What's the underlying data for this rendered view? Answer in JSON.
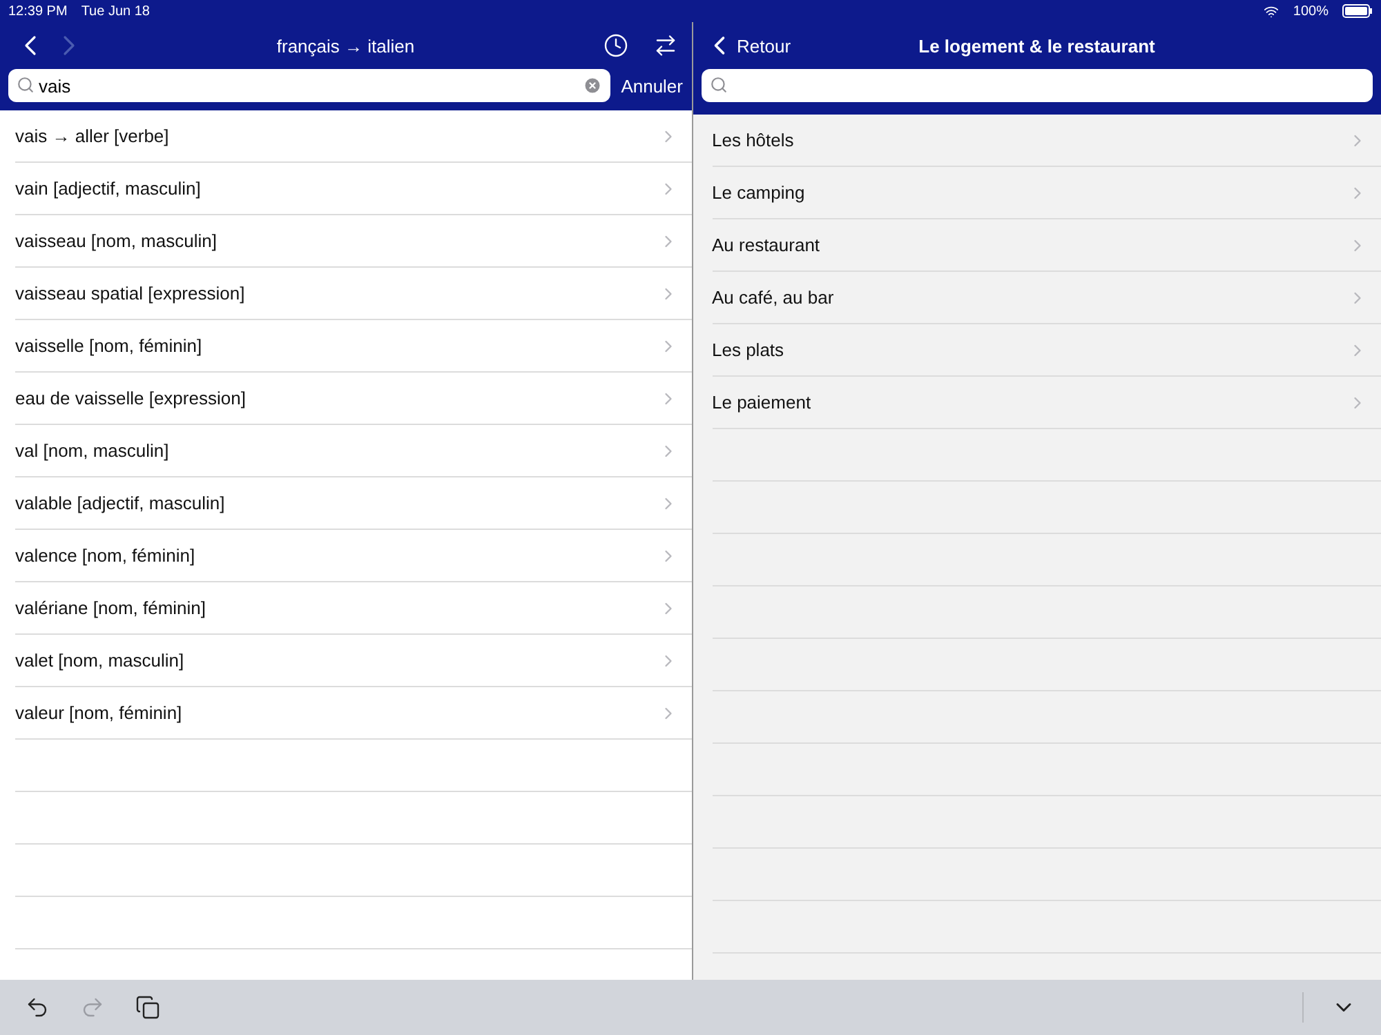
{
  "status_bar": {
    "time": "12:39 PM",
    "date": "Tue Jun 18",
    "battery": "100%"
  },
  "left_panel": {
    "nav": [
      {
        "kind": "back",
        "disabled": false
      },
      {
        "kind": "forward",
        "disabled": true
      }
    ],
    "title": "français → italien",
    "actions": [
      {
        "kind": "history"
      },
      {
        "kind": "swap"
      }
    ],
    "search": {
      "value": "vais",
      "cancel": "Annuler"
    },
    "results": [
      {
        "label": "vais → aller [verbe]"
      },
      {
        "label": "vain [adjectif, masculin]"
      },
      {
        "label": "vaisseau [nom, masculin]"
      },
      {
        "label": "vaisseau spatial [expression]"
      },
      {
        "label": "vaisselle [nom, féminin]"
      },
      {
        "label": "eau de vaisselle [expression]"
      },
      {
        "label": "val [nom, masculin]"
      },
      {
        "label": "valable [adjectif, masculin]"
      },
      {
        "label": "valence [nom, féminin]"
      },
      {
        "label": "valériane [nom, féminin]"
      },
      {
        "label": "valet [nom, masculin]"
      },
      {
        "label": "valeur [nom, féminin]"
      }
    ]
  },
  "right_panel": {
    "back": "Retour",
    "title": "Le logement & le restaurant",
    "topics": [
      {
        "label": "Les hôtels"
      },
      {
        "label": "Le camping"
      },
      {
        "label": "Au restaurant"
      },
      {
        "label": "Au café, au bar"
      },
      {
        "label": "Les plats"
      },
      {
        "label": "Le paiement"
      }
    ]
  },
  "toolbar": [
    {
      "kind": "undo",
      "disabled": false
    },
    {
      "kind": "redo",
      "disabled": true
    },
    {
      "kind": "copy",
      "disabled": false
    }
  ]
}
